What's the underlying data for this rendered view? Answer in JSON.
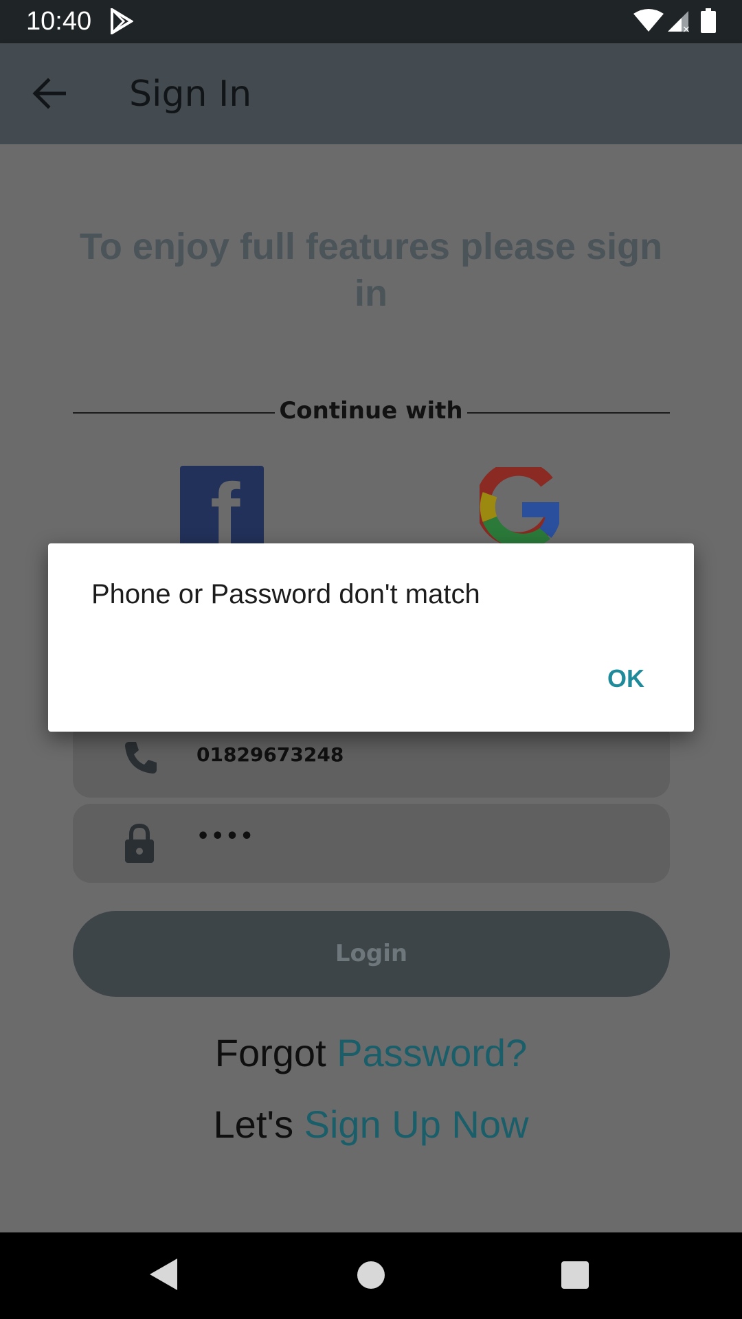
{
  "status_bar": {
    "time": "10:40",
    "icons": [
      "play-store-icon",
      "wifi-icon",
      "cell-signal-icon",
      "battery-icon"
    ]
  },
  "app_bar": {
    "title": "Sign In",
    "back_icon": "arrow-back-icon"
  },
  "content": {
    "headline": "To enjoy full features please sign in",
    "continue_with": "Continue with",
    "social": [
      {
        "name": "facebook",
        "icon": "facebook-logo-icon"
      },
      {
        "name": "google",
        "icon": "google-logo-icon"
      }
    ],
    "phone_field": {
      "icon": "phone-icon",
      "value": "01829673248"
    },
    "password_field": {
      "icon": "lock-icon",
      "value": "••••"
    },
    "login_label": "Login",
    "forgot": {
      "prefix": "Forgot ",
      "link": "Password?"
    },
    "signup": {
      "prefix": "Let's ",
      "link": "Sign Up Now"
    }
  },
  "dialog": {
    "message": "Phone or Password don't match",
    "ok_label": "OK"
  },
  "nav_bar": {
    "icons": [
      "nav-back-icon",
      "nav-home-icon",
      "nav-recents-icon"
    ]
  },
  "colors": {
    "accent": "#1f8a99",
    "link": "#1a5e6a",
    "app_bar": "#434b50",
    "scrim_bg": "#6b6b6b"
  }
}
